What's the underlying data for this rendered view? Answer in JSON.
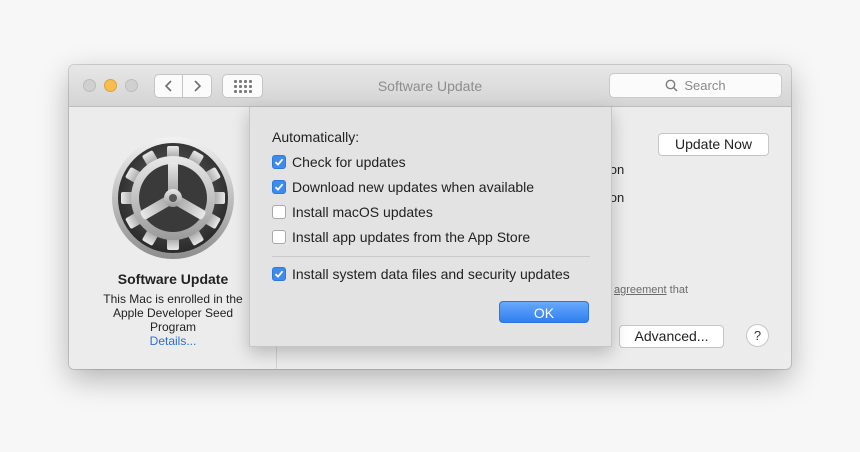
{
  "window": {
    "title": "Software Update"
  },
  "toolbar": {
    "back_icon": "chevron-left-icon",
    "forward_icon": "chevron-right-icon",
    "grid_icon": "grid-icon"
  },
  "search": {
    "placeholder": "Search",
    "icon": "search-icon"
  },
  "sidebar": {
    "icon": "gear-icon",
    "title": "Software Update",
    "description": "This Mac is enrolled in the Apple Developer Seed Program",
    "link": "Details..."
  },
  "main": {
    "update_button": "Update Now",
    "partial_line_1": "rsion",
    "partial_line_2": "rsion",
    "agreement_link": "agreement",
    "agreement_suffix": " that",
    "advanced_button": "Advanced...",
    "help_button": "?"
  },
  "sheet": {
    "heading": "Automatically:",
    "options": [
      {
        "label": "Check for updates",
        "checked": true
      },
      {
        "label": "Download new updates when available",
        "checked": true
      },
      {
        "label": "Install macOS updates",
        "checked": false
      },
      {
        "label": "Install app updates from the App Store",
        "checked": false
      },
      {
        "label": "Install system data files and security updates",
        "checked": true
      }
    ],
    "ok_button": "OK"
  },
  "colors": {
    "accent": "#3d8bf0",
    "link": "#2b6fd6",
    "minimize": "#f5be4f"
  }
}
